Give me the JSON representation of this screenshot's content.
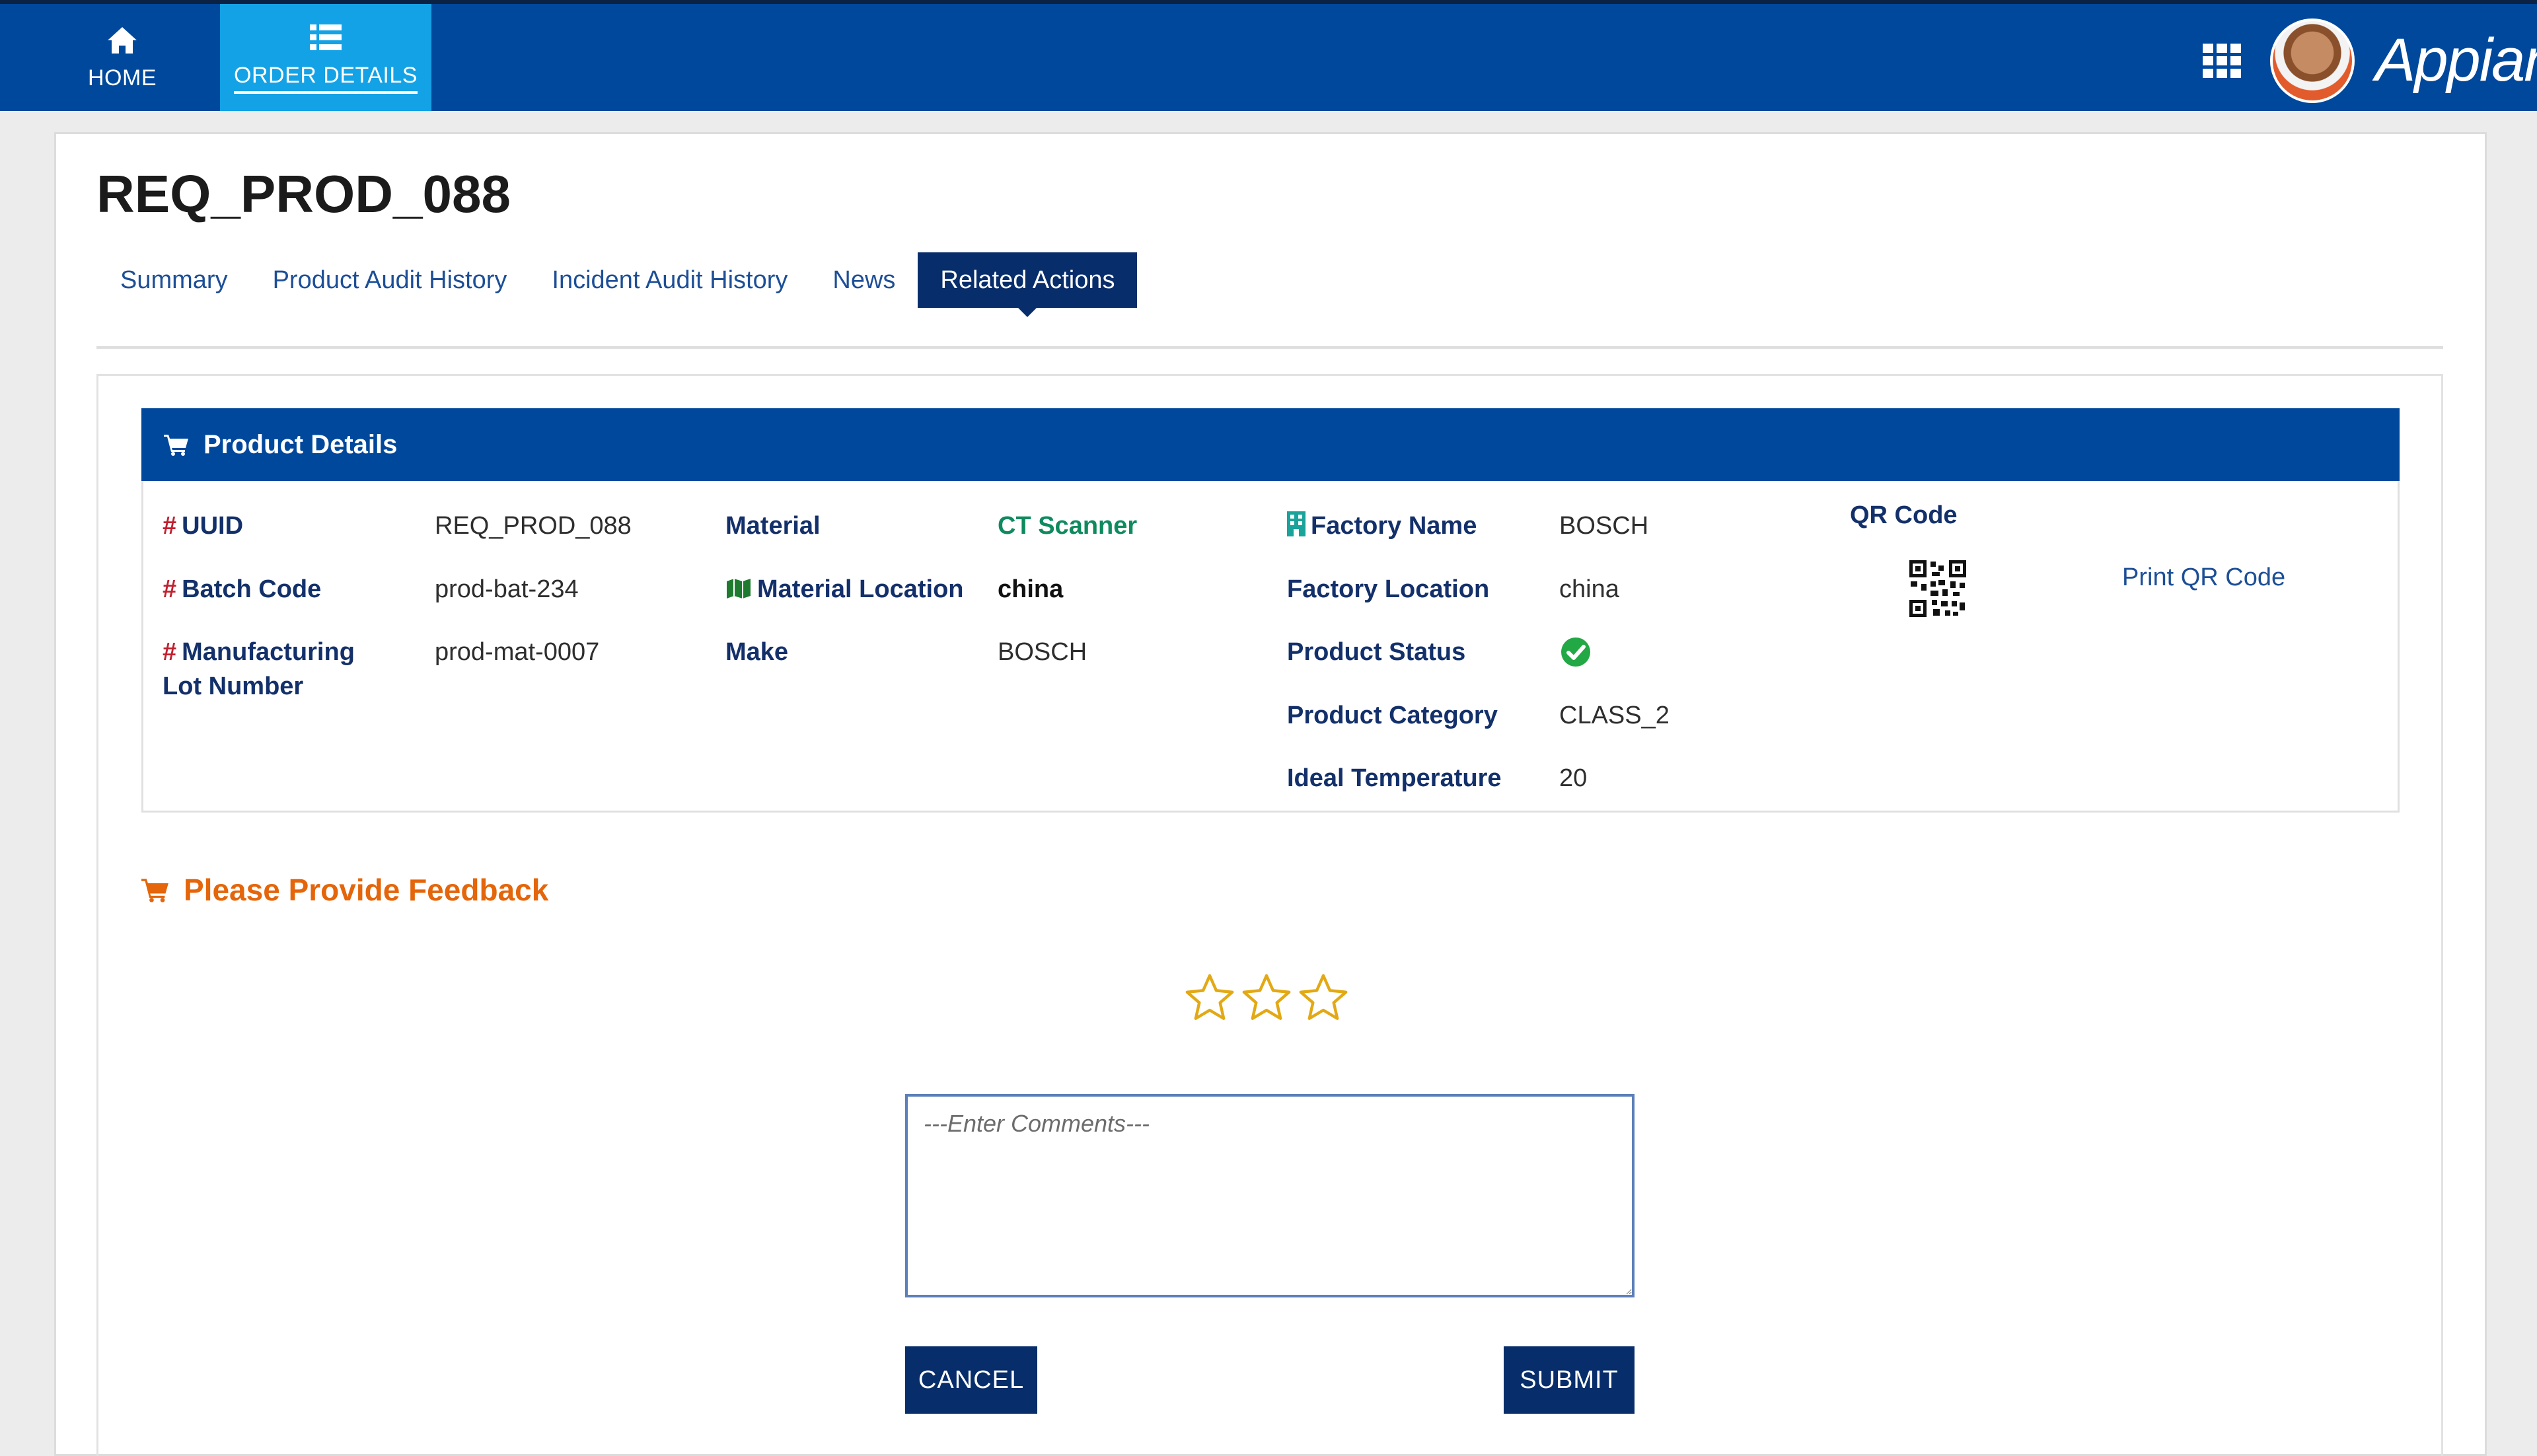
{
  "nav": {
    "home_label": "HOME",
    "order_details_label": "ORDER DETAILS",
    "logo_text": "Appian"
  },
  "page": {
    "title": "REQ_PROD_088"
  },
  "tabs": [
    {
      "label": "Summary",
      "active": false
    },
    {
      "label": "Product Audit History",
      "active": false
    },
    {
      "label": "Incident Audit History",
      "active": false
    },
    {
      "label": "News",
      "active": false
    },
    {
      "label": "Related Actions",
      "active": true
    }
  ],
  "product_details": {
    "header": "Product Details",
    "uuid_label": "UUID",
    "uuid_value": "REQ_PROD_088",
    "batch_label": "Batch Code",
    "batch_value": "prod-bat-234",
    "lot_label": "Manufacturing Lot Number",
    "lot_value": "prod-mat-0007",
    "material_label": "Material",
    "material_value": "CT Scanner",
    "material_location_label": "Material Location",
    "material_location_value": "china",
    "make_label": "Make",
    "make_value": "BOSCH",
    "factory_name_label": "Factory Name",
    "factory_name_value": "BOSCH",
    "factory_location_label": "Factory Location",
    "factory_location_value": "china",
    "product_status_label": "Product Status",
    "product_category_label": "Product Category",
    "product_category_value": "CLASS_2",
    "ideal_temp_label": "Ideal Temperature",
    "ideal_temp_value": "20",
    "qr_code_label": "QR Code",
    "print_qr_label": "Print QR Code"
  },
  "feedback": {
    "title": "Please Provide Feedback",
    "rating": 0,
    "rating_max": 3,
    "comment_placeholder": "---Enter Comments---",
    "cancel_label": "CANCEL",
    "submit_label": "SUBMIT"
  },
  "colors": {
    "nav_bg": "#00489c",
    "nav_active": "#13a2e5",
    "button_bg": "#082d6b",
    "feedback_orange": "#e4650a",
    "status_green": "#22a845",
    "star_gold": "#e3a914"
  }
}
